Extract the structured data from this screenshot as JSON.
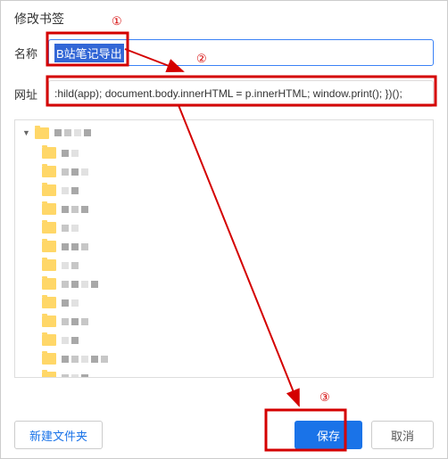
{
  "dialog": {
    "title": "修改书签",
    "name_label": "名称",
    "name_value": "B站笔记导出",
    "url_label": "网址",
    "url_value": ":hild(app); document.body.innerHTML = p.innerHTML; window.print(); })();"
  },
  "buttons": {
    "new_folder": "新建文件夹",
    "save": "保存",
    "cancel": "取消"
  },
  "annotations": {
    "m1": "①",
    "m2": "②",
    "m3": "③"
  }
}
